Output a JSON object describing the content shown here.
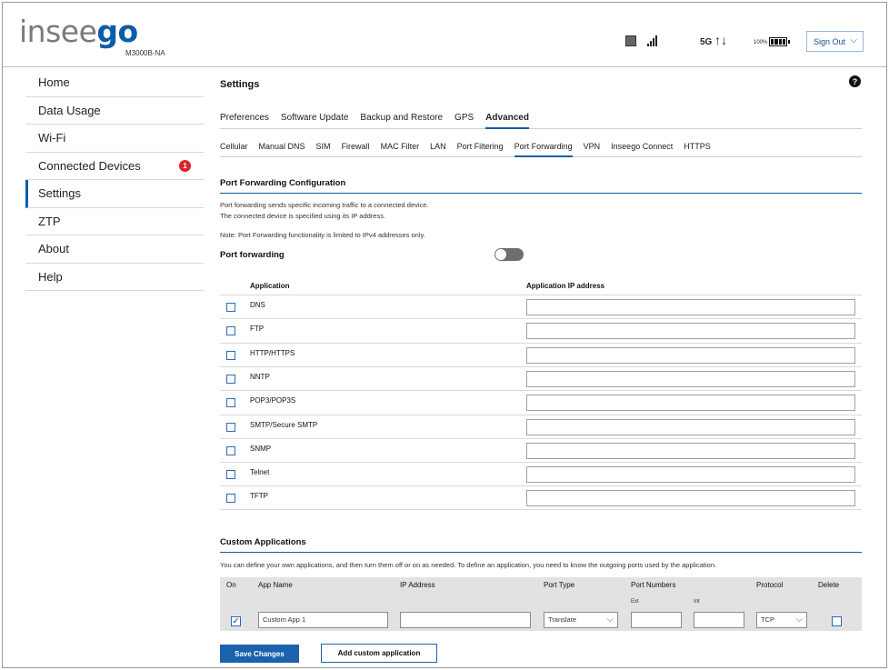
{
  "header": {
    "brand_a": "insee",
    "brand_b": "go",
    "model": "M3000B-NA",
    "network": "5G",
    "arrows": "↑↓",
    "battery_pct": "100%",
    "signout_label": "Sign Out",
    "brand_color": "#0a5ea8"
  },
  "sidebar": {
    "items": [
      {
        "label": "Home"
      },
      {
        "label": "Data Usage"
      },
      {
        "label": "Wi-Fi"
      },
      {
        "label": "Connected Devices",
        "badge": "1"
      },
      {
        "label": "Settings",
        "active": true
      },
      {
        "label": "ZTP"
      },
      {
        "label": "About"
      },
      {
        "label": "Help"
      }
    ]
  },
  "main": {
    "title": "Settings",
    "help": "?",
    "tabs": [
      "Preferences",
      "Software Update",
      "Backup and Restore",
      "GPS",
      "Advanced"
    ],
    "active_tab": "Advanced",
    "subtabs": [
      "Cellular",
      "Manual DNS",
      "SIM",
      "Firewall",
      "MAC Filter",
      "LAN",
      "Port Filtering",
      "Port Forwarding",
      "VPN",
      "Inseego Connect",
      "HTTPS"
    ],
    "active_subtab": "Port Forwarding"
  },
  "port_forwarding": {
    "section_title": "Port Forwarding Configuration",
    "desc_line1": "Port forwarding sends specific incoming traffic to a connected device.",
    "desc_line2": "The connected device is specified using its IP address.",
    "note": "Note: Port Forwarding functionality is limited to IPv4 addresses only.",
    "toggle_label": "Port forwarding",
    "toggle_state": "off",
    "col_application": "Application",
    "col_ip": "Application IP address",
    "apps": [
      {
        "name": "DNS",
        "ip": ""
      },
      {
        "name": "FTP",
        "ip": ""
      },
      {
        "name": "HTTP/HTTPS",
        "ip": ""
      },
      {
        "name": "NNTP",
        "ip": ""
      },
      {
        "name": "POP3/POP3S",
        "ip": ""
      },
      {
        "name": "SMTP/Secure SMTP",
        "ip": ""
      },
      {
        "name": "SNMP",
        "ip": ""
      },
      {
        "name": "Telnet",
        "ip": ""
      },
      {
        "name": "TFTP",
        "ip": ""
      }
    ]
  },
  "custom": {
    "section_title": "Custom Applications",
    "desc": "You can define your own applications, and then turn them off or on as needed. To define an application, you need to know the outgoing ports used by the application.",
    "headers": {
      "on": "On",
      "app_name": "App Name",
      "ip": "IP Address",
      "port_type": "Port Type",
      "port_numbers": "Port Numbers",
      "protocol": "Protocol",
      "delete": "Delete"
    },
    "sub_ext": "Ext",
    "sub_int": "Int",
    "row": {
      "on": true,
      "app_name": "Custom App 1",
      "ip": "",
      "port_type": "Translate",
      "ext": "",
      "int": "",
      "protocol": "TCP"
    }
  },
  "buttons": {
    "save": "Save Changes",
    "add": "Add custom application"
  }
}
